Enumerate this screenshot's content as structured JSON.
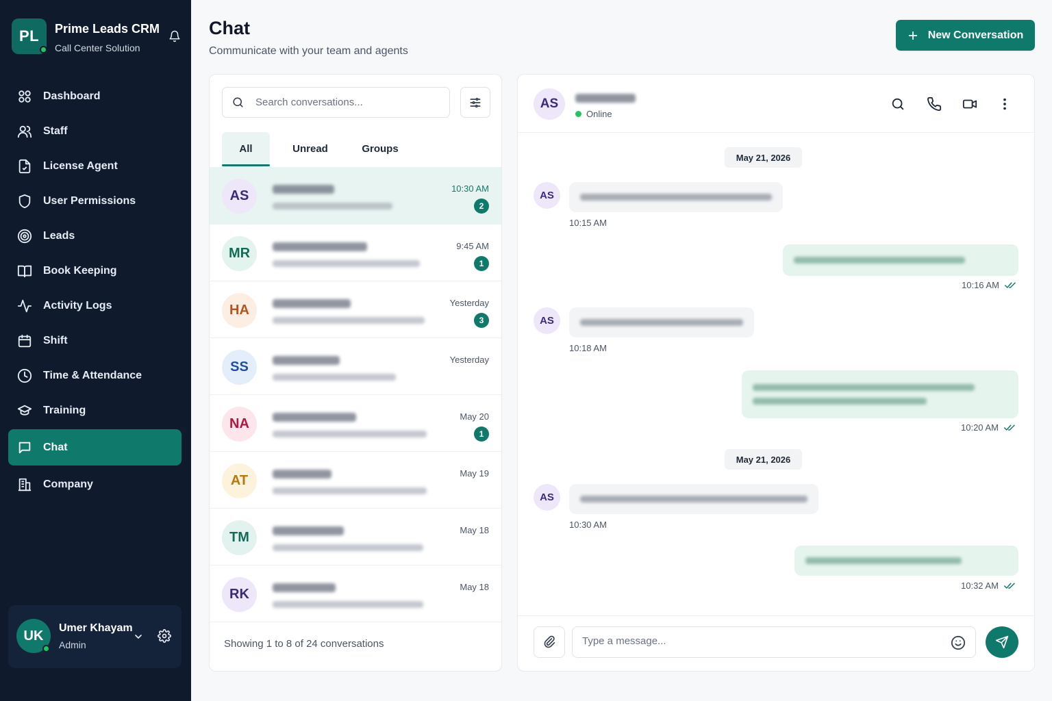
{
  "brand": {
    "initials": "PL",
    "title": "Prime Leads CRM",
    "subtitle": "Call Center Solution"
  },
  "nav": [
    {
      "label": "Dashboard",
      "icon": "dashboard-icon"
    },
    {
      "label": "Staff",
      "icon": "users-icon"
    },
    {
      "label": "License Agent",
      "icon": "document-icon"
    },
    {
      "label": "User Permissions",
      "icon": "shield-icon"
    },
    {
      "label": "Leads",
      "icon": "target-icon"
    },
    {
      "label": "Book Keeping",
      "icon": "book-icon"
    },
    {
      "label": "Activity Logs",
      "icon": "activity-icon"
    },
    {
      "label": "Shift",
      "icon": "calendar-icon"
    },
    {
      "label": "Time & Attendance",
      "icon": "clock-icon"
    },
    {
      "label": "Training",
      "icon": "graduation-cap-icon"
    },
    {
      "label": "Chat",
      "icon": "chat-icon",
      "active": true
    },
    {
      "label": "Company",
      "icon": "building-icon"
    }
  ],
  "user": {
    "initials": "UK",
    "name": "Umer Khayam",
    "role": "Admin"
  },
  "header": {
    "title": "Chat",
    "subtitle": "Communicate with your team and agents",
    "new_button": "New Conversation"
  },
  "list": {
    "search_placeholder": "Search conversations...",
    "tabs": [
      "All",
      "Unread",
      "Groups"
    ],
    "conversations": [
      {
        "initials": "AS",
        "time": "10:30 AM",
        "unread": "2",
        "active": true
      },
      {
        "initials": "MR",
        "time": "9:45 AM",
        "unread": "1"
      },
      {
        "initials": "HA",
        "time": "Yesterday",
        "unread": "3"
      },
      {
        "initials": "SS",
        "time": "Yesterday",
        "unread": ""
      },
      {
        "initials": "NA",
        "time": "May 20",
        "unread": "1"
      },
      {
        "initials": "AT",
        "time": "May 19",
        "unread": ""
      },
      {
        "initials": "TM",
        "time": "May 18",
        "unread": ""
      },
      {
        "initials": "RK",
        "time": "May 18",
        "unread": ""
      }
    ],
    "footer": "Showing 1 to 8 of 24 conversations"
  },
  "chat": {
    "initials": "AS",
    "status": "Online",
    "dates": [
      "May 21, 2026",
      "May 21, 2026"
    ],
    "times": [
      "10:15 AM",
      "10:16 AM",
      "10:18 AM",
      "10:20 AM",
      "10:30 AM",
      "10:32 AM"
    ],
    "input_placeholder": "Type a message..."
  },
  "colors": {
    "accent": "#0f7a6c",
    "sidebar": "#0f1b2d",
    "online": "#22c55e"
  }
}
